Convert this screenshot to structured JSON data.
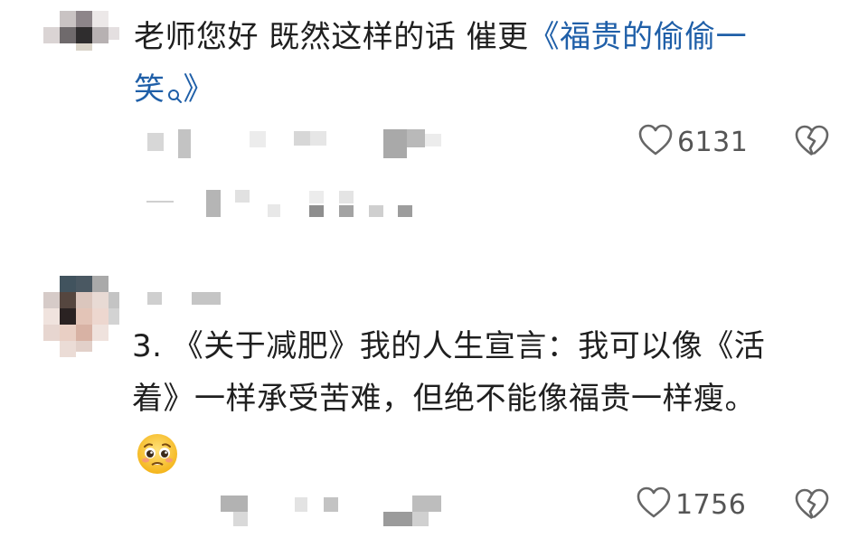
{
  "comments": [
    {
      "text_prefix": "老师您好 既然这样的话 催更",
      "link_line1": "《福贵的偷偷一",
      "link_line2": "笑",
      "link_suffix": "》",
      "likes": "6131",
      "icons": {
        "like": "heart-outline-icon",
        "dislike": "broken-heart-icon",
        "search": "search-icon"
      }
    },
    {
      "line1": "3. 《关于减肥》我的人生宣言：我可以像《活",
      "line2": "着》一样承受苦难，但绝不能像福贵一样瘦。",
      "emoji": "pleading-face-emoji",
      "likes": "1756",
      "icons": {
        "like": "heart-outline-icon",
        "dislike": "broken-heart-icon"
      }
    }
  ],
  "colors": {
    "link": "#1f5fa8",
    "text": "#1f1f1f",
    "meta": "#555555",
    "mosaic": "#c8c8c8"
  }
}
